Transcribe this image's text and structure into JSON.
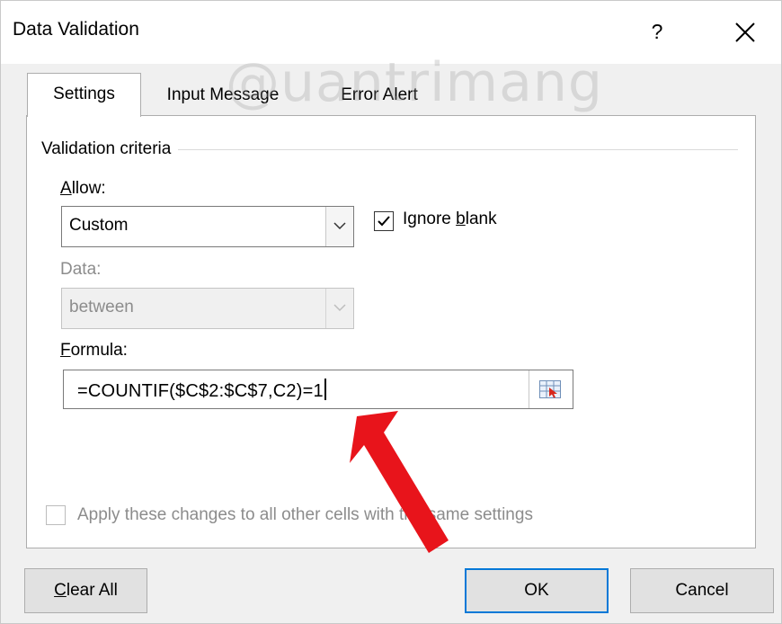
{
  "window": {
    "title": "Data Validation",
    "help_label": "?"
  },
  "tabs": [
    {
      "label": "Settings",
      "active": true
    },
    {
      "label": "Input Message",
      "active": false
    },
    {
      "label": "Error Alert",
      "active": false
    }
  ],
  "settings": {
    "group_label": "Validation criteria",
    "allow": {
      "label": "Allow:",
      "value": "Custom"
    },
    "ignore_blank": {
      "label": "Ignore blank",
      "checked": true
    },
    "data": {
      "label": "Data:",
      "value": "between",
      "disabled": true
    },
    "formula": {
      "label": "Formula:",
      "value": "=COUNTIF($C$2:$C$7,C2)=1"
    },
    "apply_all": {
      "label": "Apply these changes to all other cells with the same settings",
      "checked": false,
      "disabled": true
    }
  },
  "buttons": {
    "clear_all": "Clear All",
    "ok": "OK",
    "cancel": "Cancel"
  },
  "watermark": "@uantrimang",
  "colors": {
    "accent": "#0078d7",
    "annotation_arrow": "#e8141b"
  },
  "icons": [
    "close-icon",
    "chevron-down-icon",
    "checkmark-icon",
    "range-selector-icon"
  ]
}
